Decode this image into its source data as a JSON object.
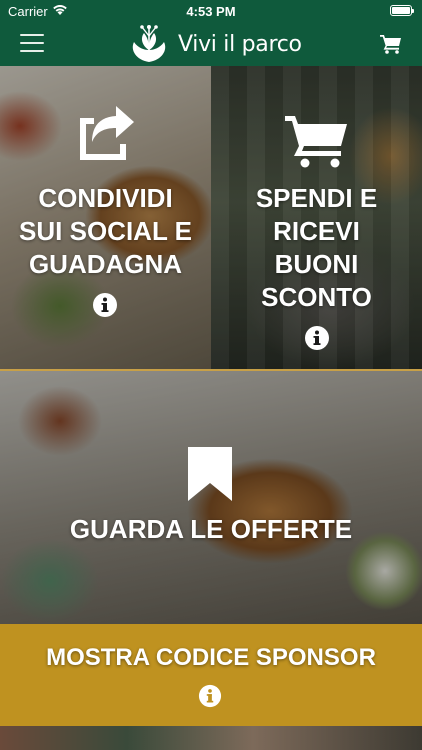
{
  "status_bar": {
    "carrier": "Carrier",
    "time": "4:53 PM",
    "battery_level": 1.0
  },
  "navbar": {
    "title": "Vivi il parco",
    "menu_icon": "hamburger-menu-icon",
    "cart_icon": "cart-icon",
    "logo_icon": "park-logo-icon"
  },
  "tiles": {
    "share": {
      "label": "CONDIVIDI\nSUI SOCIAL E\nGUADAGNA",
      "icon": "share-icon",
      "info_icon": "info-icon"
    },
    "spend": {
      "label": "SPENDI E\nRICEVI\nBUONI\nSCONTO",
      "icon": "shopping-cart-icon",
      "info_icon": "info-icon"
    },
    "offers": {
      "label": "GUARDA LE OFFERTE",
      "icon": "bookmark-icon"
    },
    "sponsor": {
      "label": "MOSTRA CODICE SPONSOR",
      "info_icon": "info-icon"
    }
  },
  "colors": {
    "brand_green": "#0f5a3c",
    "sponsor_gold": "#bf9220",
    "divider_gold": "#c8a047"
  }
}
